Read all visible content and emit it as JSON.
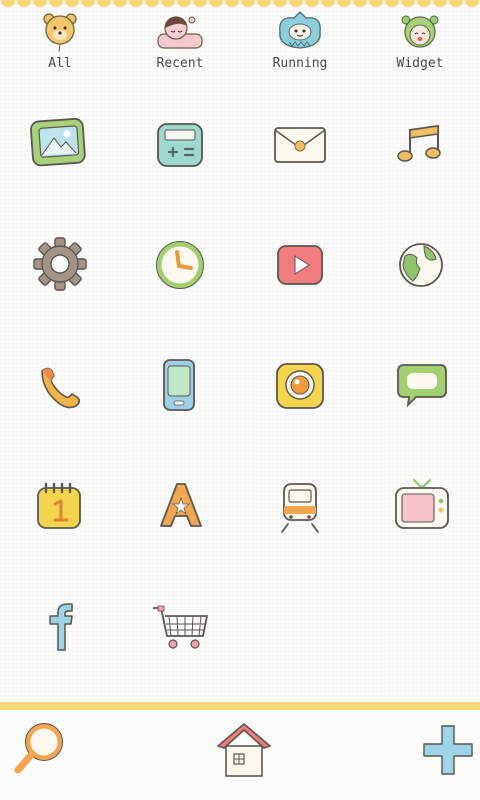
{
  "tabs": [
    {
      "label": "All",
      "icon": "bear-balloon-icon"
    },
    {
      "label": "Recent",
      "icon": "sleeping-girl-icon"
    },
    {
      "label": "Running",
      "icon": "blue-monster-icon"
    },
    {
      "label": "Widget",
      "icon": "green-hood-girl-icon"
    }
  ],
  "apps": [
    {
      "name": "gallery",
      "icon": "gallery-picture-icon"
    },
    {
      "name": "calculator",
      "icon": "calculator-icon"
    },
    {
      "name": "email",
      "icon": "envelope-icon"
    },
    {
      "name": "music",
      "icon": "music-note-icon"
    },
    {
      "name": "settings",
      "icon": "gear-icon"
    },
    {
      "name": "clock",
      "icon": "clock-icon"
    },
    {
      "name": "video",
      "icon": "play-icon"
    },
    {
      "name": "browser",
      "icon": "globe-icon"
    },
    {
      "name": "phone",
      "icon": "phone-handset-icon"
    },
    {
      "name": "contacts",
      "icon": "mobile-phone-icon"
    },
    {
      "name": "camera",
      "icon": "camera-icon"
    },
    {
      "name": "messaging",
      "icon": "chat-bubble-icon"
    },
    {
      "name": "calendar",
      "icon": "calendar-icon"
    },
    {
      "name": "app-store",
      "icon": "store-a-icon"
    },
    {
      "name": "transit",
      "icon": "train-icon"
    },
    {
      "name": "tv",
      "icon": "tv-icon"
    },
    {
      "name": "facebook",
      "icon": "facebook-f-icon"
    },
    {
      "name": "shopping",
      "icon": "shopping-cart-icon"
    }
  ],
  "dock": [
    {
      "name": "search",
      "icon": "magnifier-icon"
    },
    {
      "name": "home",
      "icon": "house-icon"
    },
    {
      "name": "add",
      "icon": "plus-icon"
    }
  ],
  "colors": {
    "scallop": "#f6d77a",
    "outline": "#5a5650",
    "text": "#4d4a45"
  }
}
